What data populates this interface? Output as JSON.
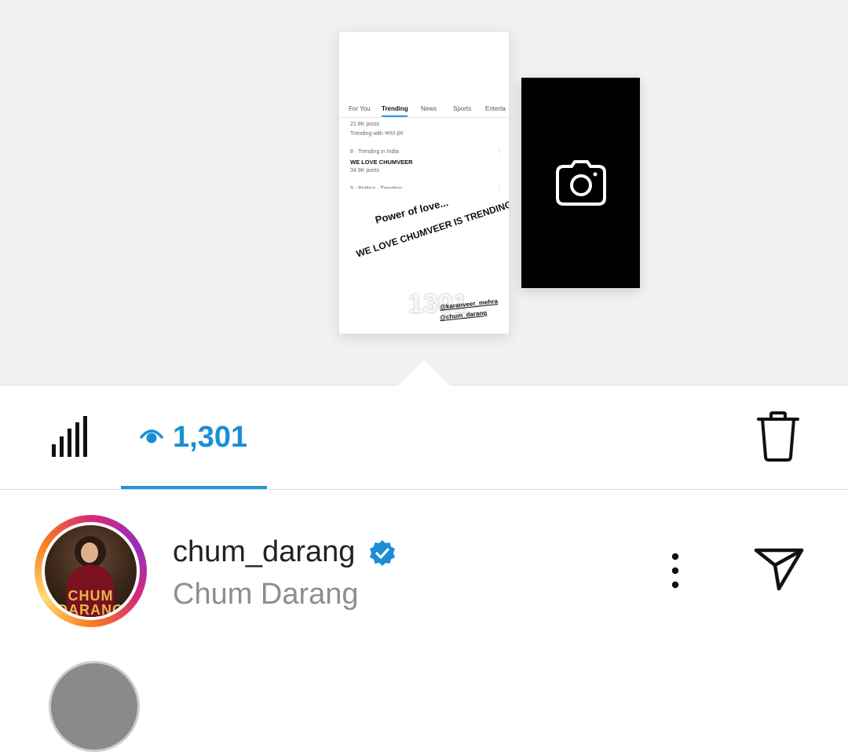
{
  "story_preview": {
    "tabs": [
      "For You",
      "Trending",
      "News",
      "Sports",
      "Enterta"
    ],
    "lines": [
      {
        "text": "22.8K posts",
        "style": "normal"
      },
      {
        "text": "Trending with भारत हम",
        "style": "normal"
      },
      {
        "text": "8 · Trending in India",
        "style": "normal"
      },
      {
        "text": "WE LOVE CHUMVEER",
        "style": "bold"
      },
      {
        "text": "34.9K posts",
        "style": "normal"
      },
      {
        "text": "9 · Politics · Trending",
        "style": "normal"
      }
    ],
    "caption_1": "Power of love...",
    "caption_2": "WE LOVE CHUMVEER IS TRENDING",
    "overlay_count": "1301",
    "credit_1": "@karanveer_mehra",
    "credit_2": "@chum_darang"
  },
  "add_story_card": {
    "icon": "camera-icon"
  },
  "stats": {
    "insights_icon": "bar-chart-icon",
    "views_icon": "eye-icon",
    "views_count": "1,301",
    "delete_icon": "trash-icon",
    "accent_color": "#1a8fd6"
  },
  "viewer": {
    "username": "chum_darang",
    "full_name": "Chum Darang",
    "verified": true,
    "avatar_text_1": "CHUM",
    "avatar_text_2": "DARANG",
    "more_icon": "more-vertical-icon",
    "send_icon": "send-icon"
  }
}
